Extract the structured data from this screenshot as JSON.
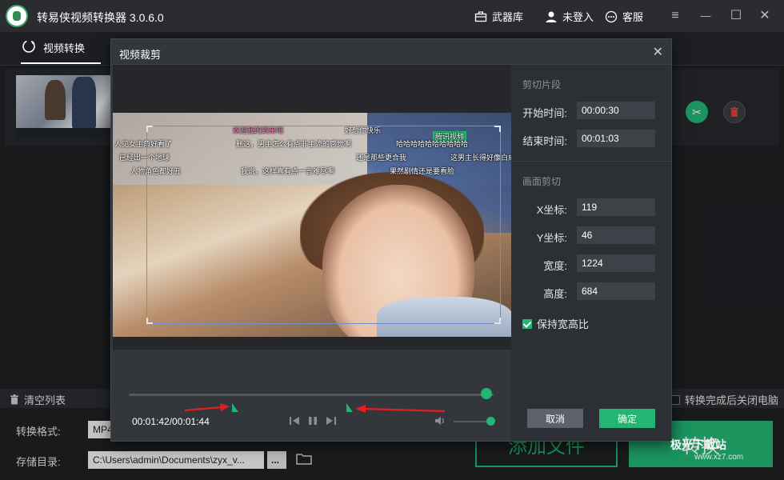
{
  "app": {
    "title": "转易侠视频转换器  3.0.6.0",
    "arsenal_label": "武器库",
    "login_label": "未登入",
    "service_label": "客服",
    "win_menu": "≡",
    "win_min": "—",
    "win_max": "☐",
    "win_close": "✕"
  },
  "tabs": {
    "video_convert": "视频转换"
  },
  "file_list": {
    "cut_icon": "✂",
    "delete_icon": "🗑"
  },
  "bottom": {
    "clear_list": "清空列表",
    "auto_close": "转换完成后关闭电脑",
    "format_label": "转换格式:",
    "format_value": "MP4",
    "dir_label": "存储目录:",
    "dir_value": "C:\\Users\\admin\\Documents\\zyx_v...",
    "dir_more": "...",
    "add_file": "添加文件",
    "convert": "转换"
  },
  "dialog": {
    "title": "视频裁剪",
    "close": "✕",
    "clip_section": "剪切片段",
    "start_label": "开始时间:",
    "start_value": "00:00:30",
    "end_label": "结束时间:",
    "end_value": "00:01:03",
    "crop_section": "画面剪切",
    "x_label": "X坐标:",
    "x_value": "119",
    "y_label": "Y坐标:",
    "y_value": "46",
    "width_label": "宽度:",
    "width_value": "1224",
    "height_label": "高度:",
    "height_value": "684",
    "keep_ratio": "保持宽高比",
    "keep_ratio_checked": true,
    "cancel": "取消",
    "ok": "确定",
    "time": "00:01:42/00:01:44",
    "playback_progress": 0.98,
    "volume_level": 1.0
  },
  "video": {
    "danmaku": [
      "欢迎我的到来吧",
      "好想你快乐",
      "腾讯视频",
      "人见女主角好看了",
      "删这，男主怎么有点非主流的感觉啊",
      "哈哈哈哈哈哈哈哈哈哈",
      "已经出一个地球",
      "还是那些更合我",
      "这男主长得好像白成",
      "人物角色都好丑",
      "我说，这样真有点一言难尽啊",
      "果然剧情还是要看脸"
    ]
  },
  "watermark": {
    "text": "极光下载站",
    "sub": "www.xz7.com"
  },
  "colors": {
    "accent": "#22b573",
    "annotation_arrow": "#e41f1f"
  }
}
